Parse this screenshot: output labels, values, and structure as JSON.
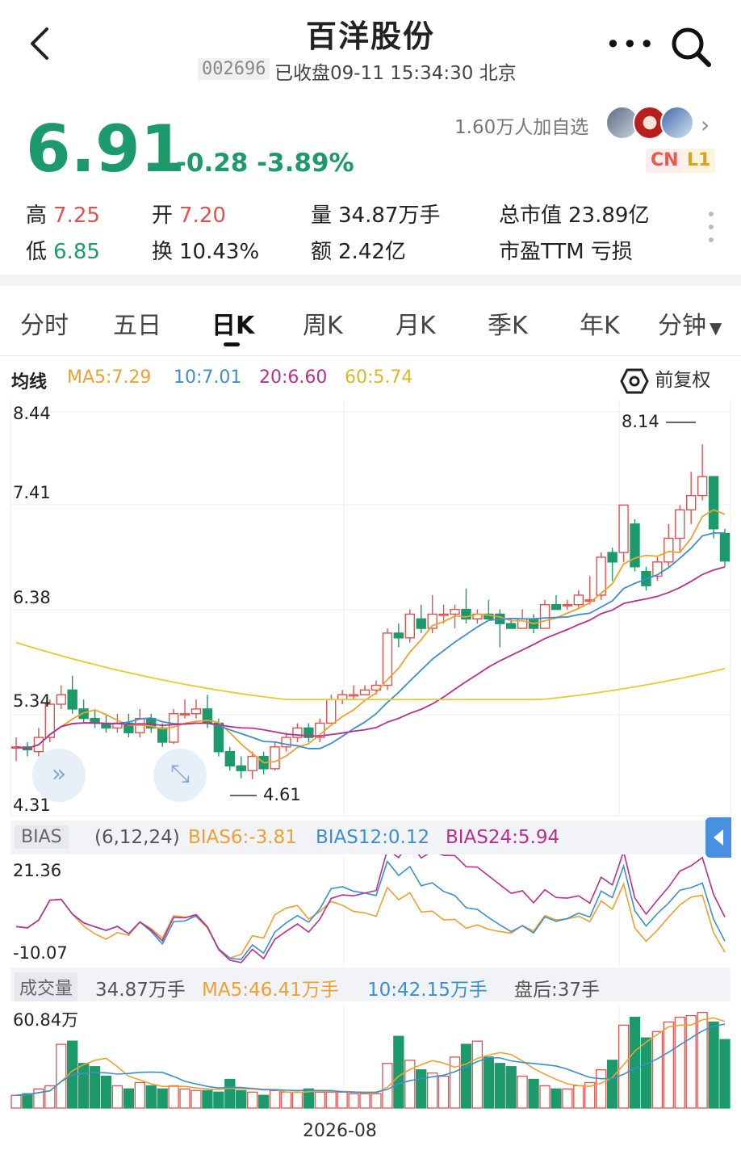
{
  "header": {
    "title": "百洋股份",
    "code": "002696",
    "status": "已收盘09-11 15:34:30 北京",
    "more_glyph": "•••"
  },
  "quote": {
    "price": "6.91",
    "change": "-0.28 -3.89%",
    "watch_count": "1.60万人加自选",
    "badge_cn": "CN",
    "badge_l1": "L1",
    "stats": {
      "high_label": "高",
      "high": "7.25",
      "open_label": "开",
      "open": "7.20",
      "volume_label": "量",
      "volume": "34.87万手",
      "mcap_label": "总市值",
      "mcap": "23.89亿",
      "low_label": "低",
      "low": "6.85",
      "turnover_label": "换",
      "turnover": "10.43%",
      "amount_label": "额",
      "amount": "2.42亿",
      "pe_label": "市盈TTM",
      "pe": "亏损"
    }
  },
  "tabs": [
    "分时",
    "五日",
    "日K",
    "周K",
    "月K",
    "季K",
    "年K",
    "分钟"
  ],
  "active_tab": 2,
  "ma_legend": {
    "label": "均线",
    "ma5": "MA5:7.29",
    "ma10": "10:7.01",
    "ma20": "20:6.60",
    "ma60": "60:5.74",
    "adjust": "前复权"
  },
  "kchart": {
    "y_ticks": [
      "8.44",
      "7.41",
      "6.38",
      "5.34",
      "4.31"
    ],
    "max_label": "8.14",
    "min_label": "4.61"
  },
  "bias": {
    "tag": "BIAS",
    "params": "(6,12,24)",
    "bias6": "BIAS6:-3.81",
    "bias12": "BIAS12:0.12",
    "bias24": "BIAS24:5.94",
    "y_top": "21.36",
    "y_bottom": "-10.07"
  },
  "volume": {
    "tag": "成交量",
    "value": "34.87万手",
    "ma5": "MA5:46.41万手",
    "ma10": "10:42.15万手",
    "after_hours": "盘后:37手",
    "y_top": "60.84万",
    "x_label": "2026-08"
  },
  "colors": {
    "up": "#e0524f",
    "down": "#1d9a6b",
    "ma5": "#f0a030",
    "ma10": "#3a8fd0",
    "ma20": "#b8308f",
    "ma60": "#e8c930"
  }
}
